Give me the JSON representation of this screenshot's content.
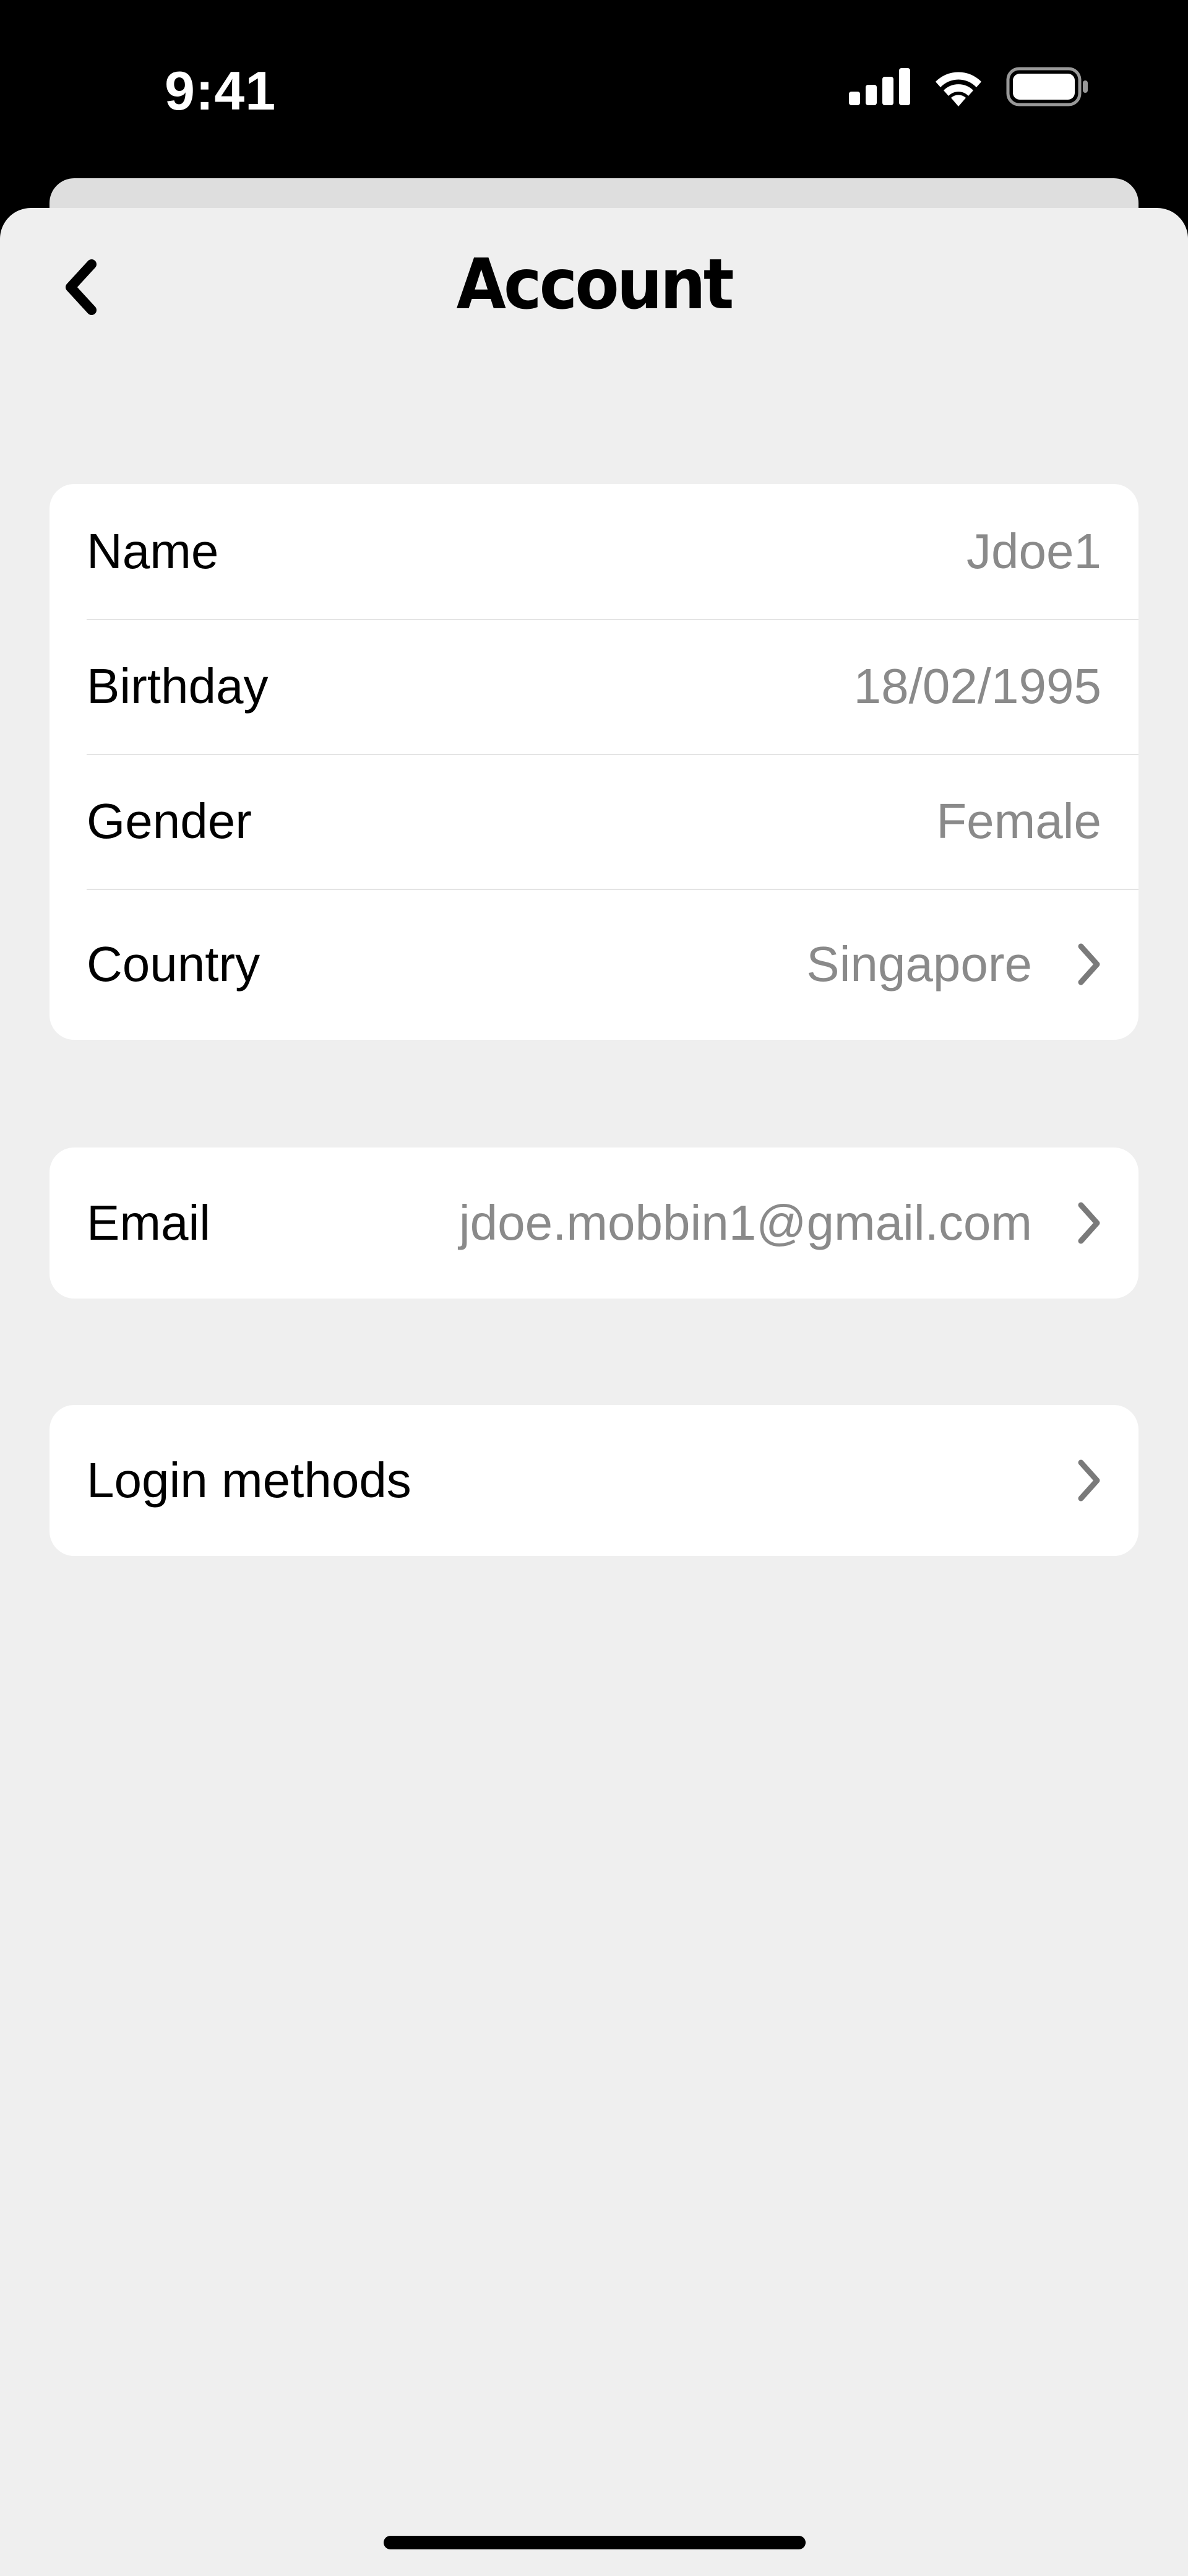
{
  "status_bar": {
    "time": "9:41",
    "icons": [
      "cellular-signal-icon",
      "wifi-icon",
      "battery-icon"
    ]
  },
  "header": {
    "title": "Account",
    "back_icon": "chevron-left-icon"
  },
  "profile_card": {
    "rows": [
      {
        "label": "Name",
        "value": "Jdoe1"
      },
      {
        "label": "Birthday",
        "value": "18/02/1995"
      },
      {
        "label": "Gender",
        "value": "Female"
      },
      {
        "label": "Country",
        "value": "Singapore",
        "chevron": "chevron-right-icon"
      }
    ]
  },
  "email_card": {
    "label": "Email",
    "value": "jdoe.mobbin1@gmail.com",
    "chevron": "chevron-right-icon"
  },
  "login_card": {
    "label": "Login methods",
    "chevron": "chevron-right-icon"
  },
  "colors": {
    "background": "#efefef",
    "card": "#ffffff",
    "label_text": "#000000",
    "value_text": "#8a8a8a",
    "chevron": "#7a7a7a",
    "status_bar": "#000000"
  }
}
